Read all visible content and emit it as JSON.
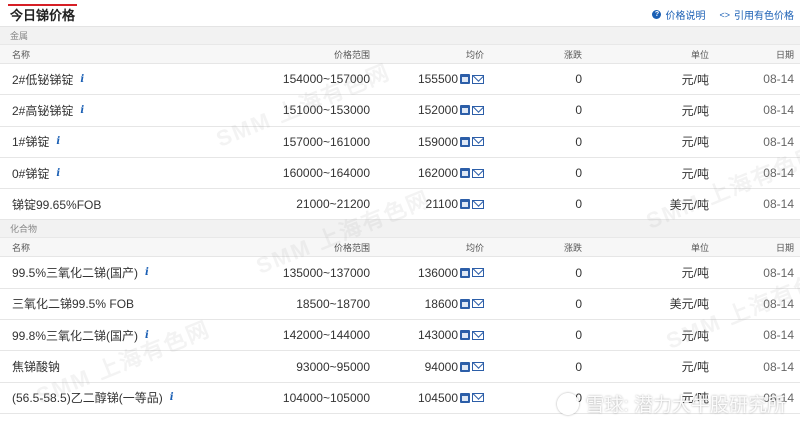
{
  "header": {
    "title": "今日锑价格",
    "help_label": "价格说明",
    "cite_label": "引用有色价格"
  },
  "columns": {
    "name": "名称",
    "range": "价格范围",
    "avg": "均价",
    "change": "涨跌",
    "unit": "单位",
    "date": "日期"
  },
  "sections": [
    {
      "label": "金属",
      "rows": [
        {
          "name": "2#低铋锑锭",
          "info": true,
          "range": "154000~157000",
          "avg": "155500",
          "change": "0",
          "unit": "元/吨",
          "date": "08-14"
        },
        {
          "name": "2#高铋锑锭",
          "info": true,
          "range": "151000~153000",
          "avg": "152000",
          "change": "0",
          "unit": "元/吨",
          "date": "08-14"
        },
        {
          "name": "1#锑锭",
          "info": true,
          "range": "157000~161000",
          "avg": "159000",
          "change": "0",
          "unit": "元/吨",
          "date": "08-14"
        },
        {
          "name": "0#锑锭",
          "info": true,
          "range": "160000~164000",
          "avg": "162000",
          "change": "0",
          "unit": "元/吨",
          "date": "08-14"
        },
        {
          "name": "锑锭99.65%FOB",
          "info": false,
          "range": "21000~21200",
          "avg": "21100",
          "change": "0",
          "unit": "美元/吨",
          "date": "08-14"
        }
      ]
    },
    {
      "label": "化合物",
      "rows": [
        {
          "name": "99.5%三氧化二锑(国产)",
          "info": true,
          "range": "135000~137000",
          "avg": "136000",
          "change": "0",
          "unit": "元/吨",
          "date": "08-14"
        },
        {
          "name": "三氧化二锑99.5% FOB",
          "info": false,
          "range": "18500~18700",
          "avg": "18600",
          "change": "0",
          "unit": "美元/吨",
          "date": "08-14"
        },
        {
          "name": "99.8%三氧化二锑(国产)",
          "info": true,
          "range": "142000~144000",
          "avg": "143000",
          "change": "0",
          "unit": "元/吨",
          "date": "08-14"
        },
        {
          "name": "焦锑酸钠",
          "info": false,
          "range": "93000~95000",
          "avg": "94000",
          "change": "0",
          "unit": "元/吨",
          "date": "08-14"
        },
        {
          "name": "(56.5-58.5)乙二醇锑(一等品)",
          "info": true,
          "range": "104000~105000",
          "avg": "104500",
          "change": "0",
          "unit": "元/吨",
          "date": "08-14"
        }
      ]
    }
  ],
  "watermark": {
    "text": "SMM 上海有色网",
    "overlay": "雪球: 潜力大牛股研究所"
  }
}
